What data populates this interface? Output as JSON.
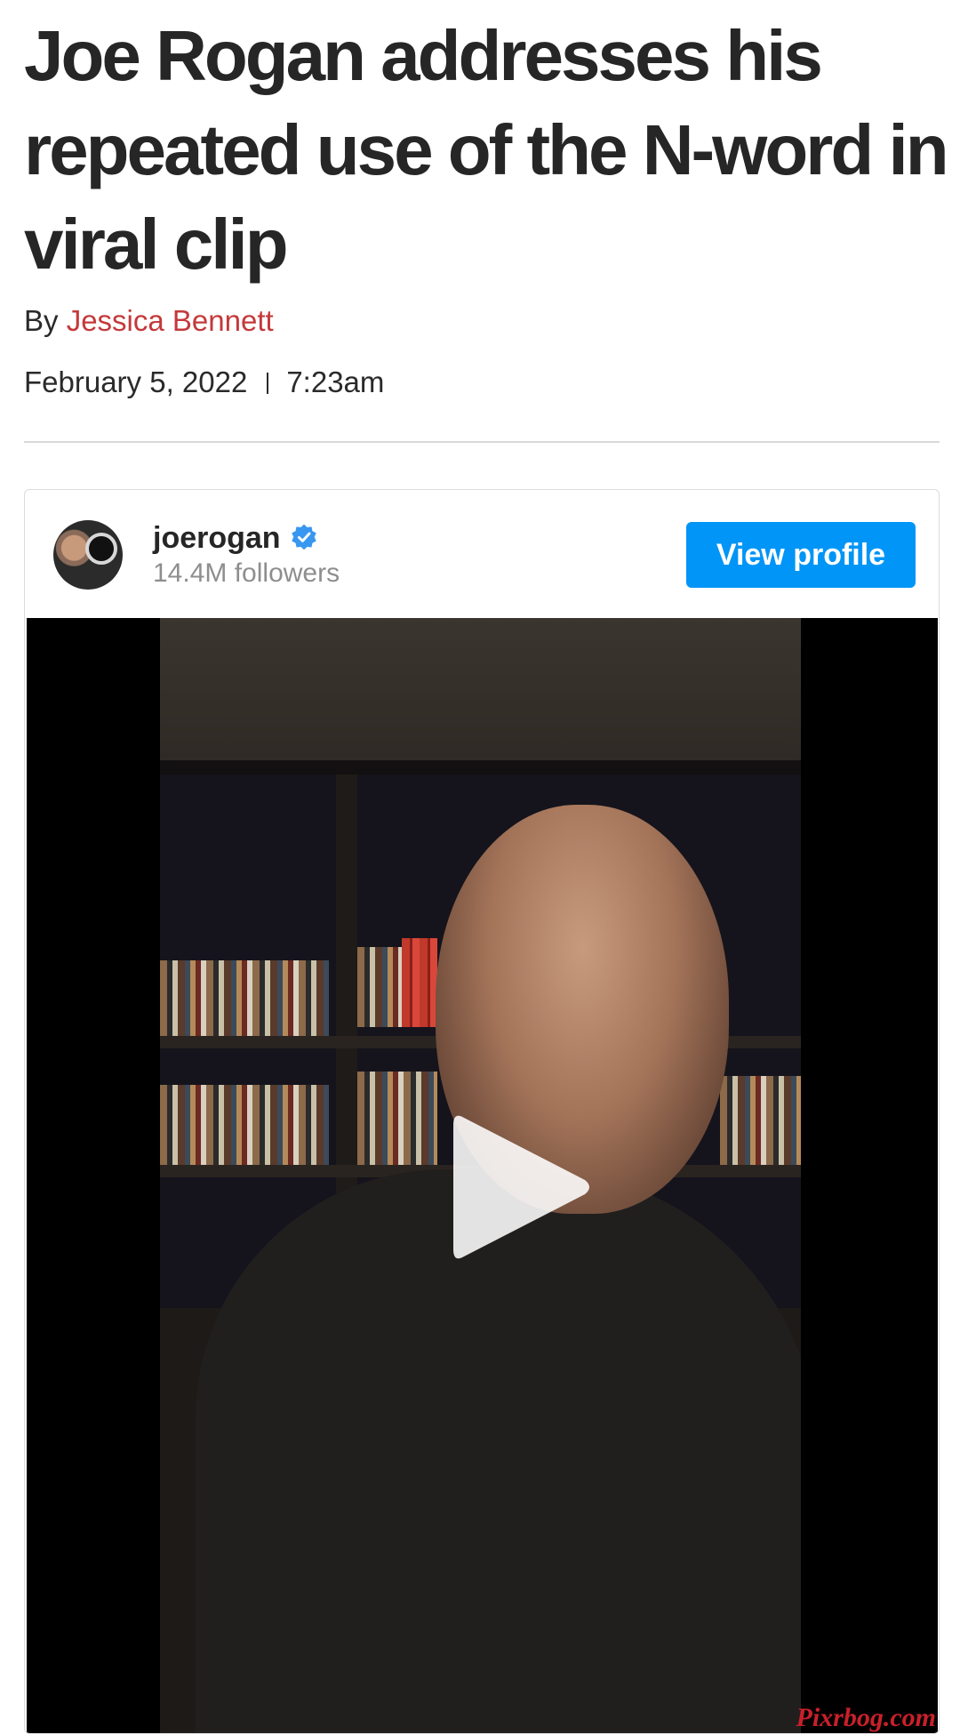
{
  "article": {
    "headline": "Joe Rogan addresses his repeated use of the N-word in viral clip",
    "byline_prefix": "By",
    "author": "Jessica Bennett",
    "date": "February 5, 2022",
    "time": "7:23am"
  },
  "embed": {
    "username": "joerogan",
    "verified": true,
    "followers": "14.4M followers",
    "view_profile_label": "View profile",
    "media": {
      "type": "video",
      "play_icon": "play-icon"
    }
  },
  "watermark": "Pixrbog.com",
  "colors": {
    "author_link": "#c4393b",
    "view_profile_bg": "#0095f6",
    "verified_badge": "#3897f0",
    "followers_text": "#8e8e8e",
    "watermark": "#c8202a"
  }
}
